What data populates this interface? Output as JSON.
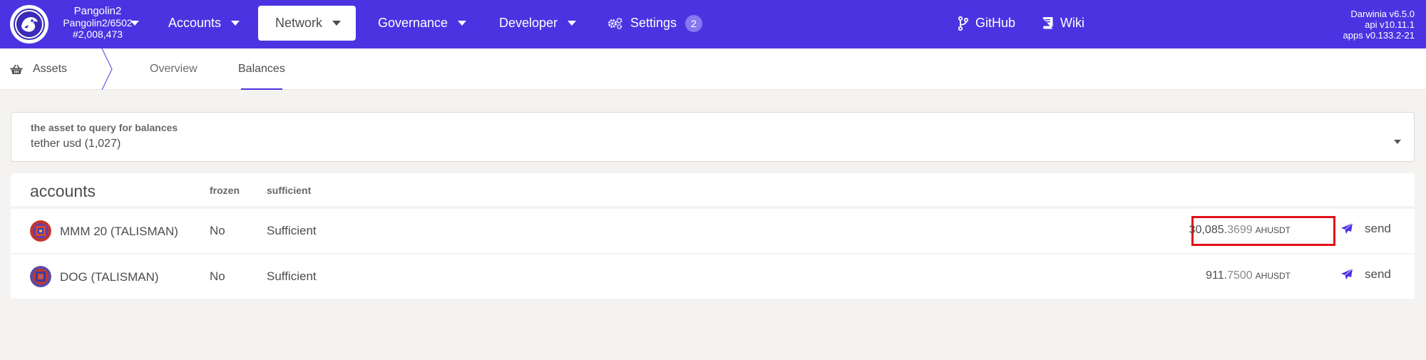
{
  "header": {
    "chain": {
      "name": "Pangolin2",
      "runtime": "Pangolin2/6502",
      "block": "#2,008,473"
    },
    "nav": [
      {
        "label": "Accounts"
      },
      {
        "label": "Network"
      },
      {
        "label": "Governance"
      },
      {
        "label": "Developer"
      },
      {
        "label": "Settings",
        "badge": "2"
      },
      {
        "label": "GitHub"
      },
      {
        "label": "Wiki"
      }
    ],
    "versions": {
      "node": "Darwinia v6.5.0",
      "api": "api v10.11.1",
      "apps": "apps v0.133.2-21"
    }
  },
  "subnav": {
    "section": "Assets",
    "tabs": [
      {
        "label": "Overview"
      },
      {
        "label": "Balances"
      }
    ],
    "active_tab": "Balances"
  },
  "asset_selector": {
    "label": "the asset to query for balances",
    "value": "tether usd (1,027)"
  },
  "table": {
    "title": "accounts",
    "columns": {
      "frozen": "frozen",
      "sufficient": "sufficient"
    },
    "rows": [
      {
        "name": "MMM 20 (TALISMAN)",
        "frozen": "No",
        "sufficient": "Sufficient",
        "balance_int": "30,085.",
        "balance_dec": "3699",
        "unit": "AHUSDT",
        "action": "send",
        "highlighted": true
      },
      {
        "name": "DOG (TALISMAN)",
        "frozen": "No",
        "sufficient": "Sufficient",
        "balance_int": "911.",
        "balance_dec": "7500",
        "unit": "AHUSDT",
        "action": "send",
        "highlighted": false
      }
    ]
  },
  "colors": {
    "brand": "#4c33e1",
    "highlight": "#e0101a",
    "background": "#f4f3f1"
  }
}
